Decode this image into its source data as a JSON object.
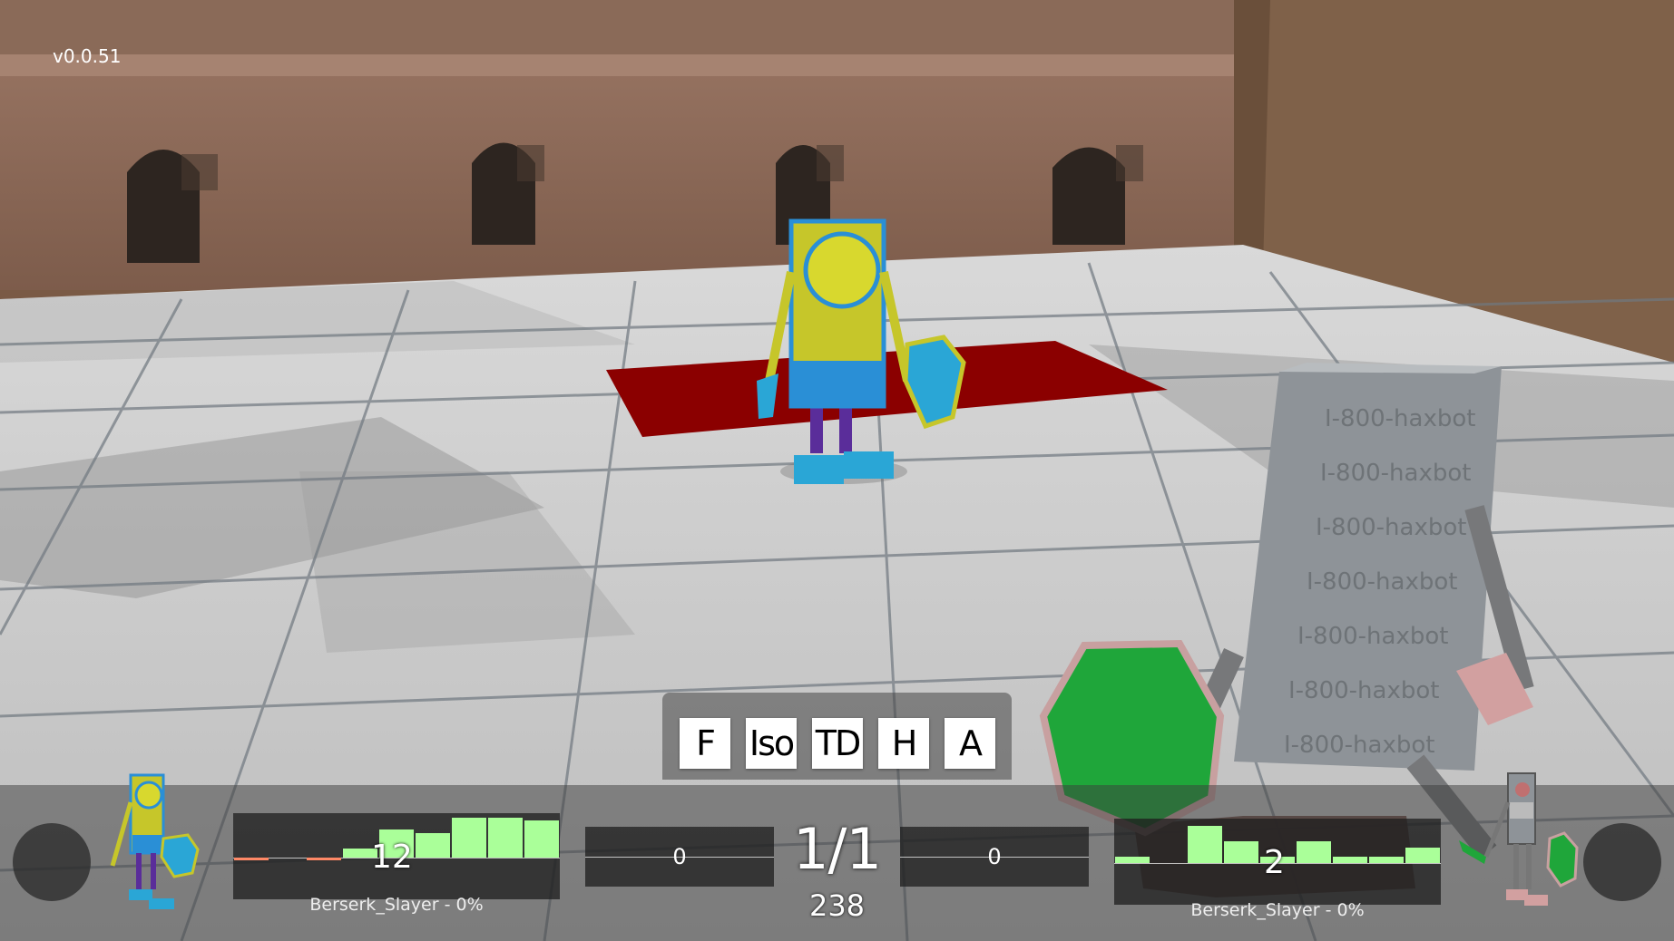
{
  "version": "v0.0.51",
  "view_modes": [
    "F",
    "Iso",
    "TD",
    "H",
    "A"
  ],
  "round": "1/1",
  "timer": "238",
  "player_left": {
    "name_label": "Berserk_Slayer - 0%",
    "score": "12",
    "side_score": "0",
    "history": [
      -0.1,
      0,
      -0.15,
      0.3,
      0.9,
      0.8,
      1.3,
      1.3,
      1.2
    ],
    "colors": {
      "bar": "#aaff99",
      "negative": "#ff8866"
    }
  },
  "player_right": {
    "name_label": "Berserk_Slayer - 0%",
    "score": "2",
    "side_score": "0",
    "history": [
      0.2,
      0,
      1.2,
      0.7,
      0.2,
      0.7,
      0.2,
      0.2,
      0.5
    ],
    "colors": {
      "bar": "#aaff99"
    }
  },
  "bot_text": "I-800-haxbot",
  "colors": {
    "mat": "#8b0000",
    "robot_body": "#c6c62a",
    "robot_trim": "#2a8fd6",
    "shield": "#1fa63a"
  }
}
